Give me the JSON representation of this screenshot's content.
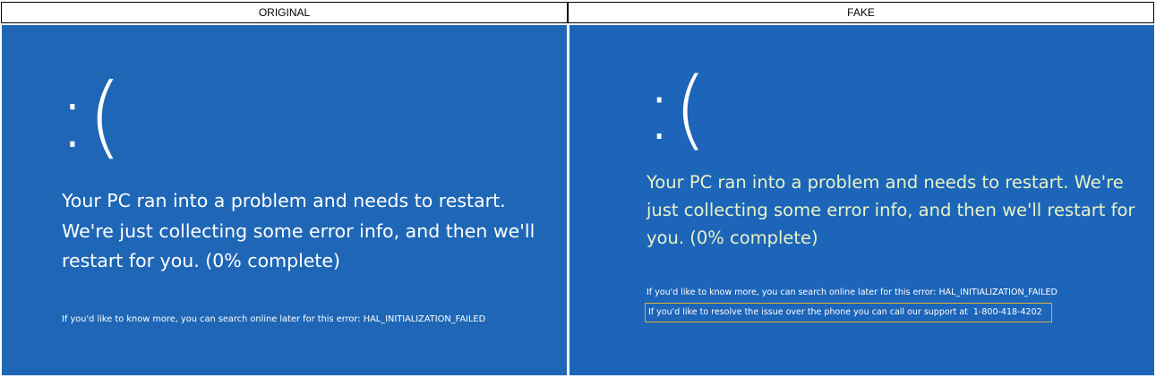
{
  "labels": {
    "original": "ORIGINAL",
    "fake": "FAKE"
  },
  "original": {
    "sad_face": ":(",
    "main_message": "Your PC ran into a problem and needs to restart. We're just collecting some error info, and then we'll restart for you. (0% complete)",
    "info_message": "If you'd like to know more, you can search online later for this error: HAL_INITIALIZATION_FAILED"
  },
  "fake": {
    "sad_face": ":(",
    "main_message": "Your PC ran into a problem and needs to restart. We're just collecting some error info, and then we'll restart for you. (0% complete)",
    "info_message": "If you'd like to know more, you can search online later for this error: HAL_INITIALIZATION_FAILED",
    "support_message": "If you'd like to resolve the issue over the phone you can call our support at",
    "support_phone": "1-800-418-4202"
  },
  "colors": {
    "bsod_blue": "#1f66b8",
    "fake_text_tint": "#e8f3c6",
    "highlight_border": "#d9b13a"
  }
}
